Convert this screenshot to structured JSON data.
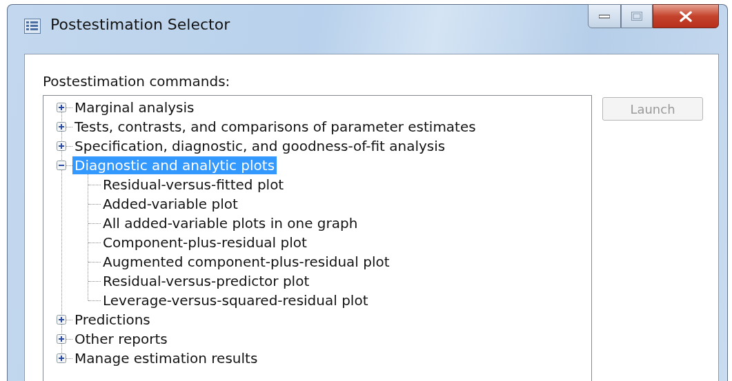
{
  "window": {
    "title": "Postestimation Selector"
  },
  "label": "Postestimation commands:",
  "tree": [
    {
      "label": "Marginal analysis",
      "expanded": false,
      "selected": false
    },
    {
      "label": "Tests, contrasts, and comparisons of parameter estimates",
      "expanded": false,
      "selected": false
    },
    {
      "label": "Specification, diagnostic, and goodness-of-fit analysis",
      "expanded": false,
      "selected": false
    },
    {
      "label": "Diagnostic and analytic plots",
      "expanded": true,
      "selected": true,
      "children": [
        {
          "label": "Residual-versus-fitted plot",
          "selected": false
        },
        {
          "label": "Added-variable plot",
          "selected": false
        },
        {
          "label": "All added-variable plots in one graph",
          "selected": false
        },
        {
          "label": "Component-plus-residual plot",
          "selected": false
        },
        {
          "label": "Augmented component-plus-residual plot",
          "selected": false
        },
        {
          "label": "Residual-versus-predictor plot",
          "selected": false
        },
        {
          "label": "Leverage-versus-squared-residual plot",
          "selected": false
        }
      ]
    },
    {
      "label": "Predictions",
      "expanded": false,
      "selected": false
    },
    {
      "label": "Other reports",
      "expanded": false,
      "selected": false
    },
    {
      "label": "Manage estimation results",
      "expanded": false,
      "selected": false
    }
  ],
  "launch_button": {
    "label": "Launch",
    "disabled": true
  }
}
